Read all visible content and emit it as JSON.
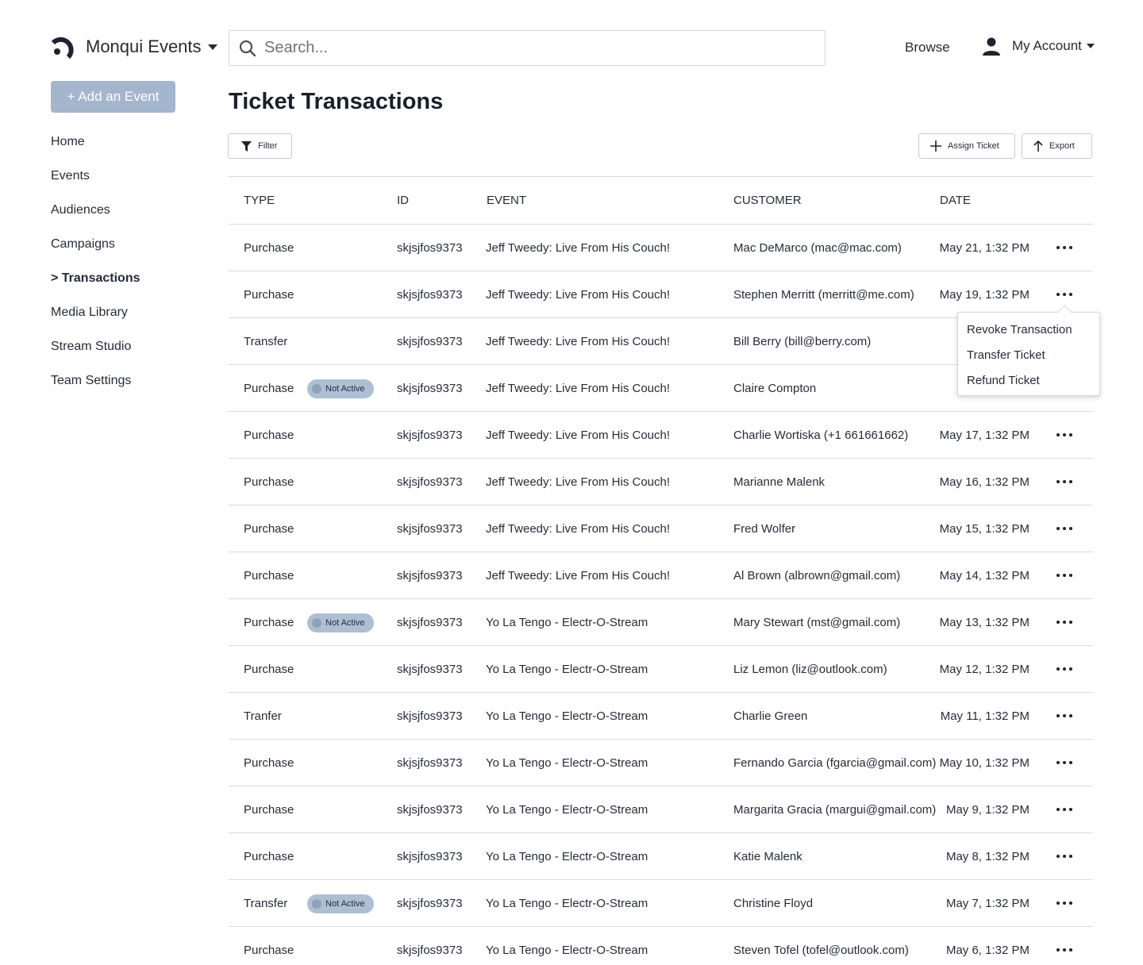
{
  "header": {
    "brand": "Monqui Events",
    "search_placeholder": "Search...",
    "browse": "Browse",
    "account": "My Account"
  },
  "sidebar": {
    "add_event": "+ Add an Event",
    "items": [
      {
        "label": "Home"
      },
      {
        "label": "Events"
      },
      {
        "label": "Audiences"
      },
      {
        "label": "Campaigns"
      },
      {
        "label": "> Transactions",
        "active": true
      },
      {
        "label": "Media Library"
      },
      {
        "label": "Stream Studio"
      },
      {
        "label": "Team Settings"
      }
    ]
  },
  "main": {
    "title": "Ticket Transactions",
    "filter": "Filter",
    "assign": "Assign Ticket",
    "export": "Export",
    "columns": {
      "type": "TYPE",
      "id": "ID",
      "event": "EVENT",
      "customer": "CUSTOMER",
      "date": "DATE"
    },
    "badge_text": "Not Active",
    "rows": [
      {
        "type": "Purchase",
        "id": "skjsjfos9373",
        "event": "Jeff Tweedy: Live From His Couch!",
        "customer": "Mac DeMarco (mac@mac.com)",
        "date": "May 21, 1:32 PM",
        "inactive": false
      },
      {
        "type": "Purchase",
        "id": "skjsjfos9373",
        "event": "Jeff Tweedy: Live From His Couch!",
        "customer": "Stephen Merritt (merritt@me.com)",
        "date": "May 19, 1:32 PM",
        "inactive": false
      },
      {
        "type": "Transfer",
        "id": "skjsjfos9373",
        "event": "Jeff Tweedy: Live From His Couch!",
        "customer": "Bill Berry (bill@berry.com)",
        "date": "Ma",
        "inactive": false
      },
      {
        "type": "Purchase",
        "id": "skjsjfos9373",
        "event": "Jeff Tweedy: Live From His Couch!",
        "customer": "Claire Compton",
        "date": "Ma",
        "inactive": true
      },
      {
        "type": "Purchase",
        "id": "skjsjfos9373",
        "event": "Jeff Tweedy: Live From His Couch!",
        "customer": "Charlie Wortiska (+1 661661662)",
        "date": "May 17, 1:32 PM",
        "inactive": false
      },
      {
        "type": "Purchase",
        "id": "skjsjfos9373",
        "event": "Jeff Tweedy: Live From His Couch!",
        "customer": "Marianne Malenk",
        "date": "May 16, 1:32 PM",
        "inactive": false
      },
      {
        "type": "Purchase",
        "id": "skjsjfos9373",
        "event": "Jeff Tweedy: Live From His Couch!",
        "customer": "Fred Wolfer",
        "date": "May 15, 1:32 PM",
        "inactive": false
      },
      {
        "type": "Purchase",
        "id": "skjsjfos9373",
        "event": "Jeff Tweedy: Live From His Couch!",
        "customer": "Al Brown (albrown@gmail.com)",
        "date": "May 14, 1:32 PM",
        "inactive": false
      },
      {
        "type": "Purchase",
        "id": "skjsjfos9373",
        "event": "Yo La Tengo - Electr-O-Stream",
        "customer": "Mary Stewart (mst@gmail.com)",
        "date": "May 13, 1:32 PM",
        "inactive": true
      },
      {
        "type": "Purchase",
        "id": "skjsjfos9373",
        "event": "Yo La Tengo - Electr-O-Stream",
        "customer": "Liz Lemon (liz@outlook.com)",
        "date": "May 12, 1:32 PM",
        "inactive": false
      },
      {
        "type": "Tranfer",
        "id": "skjsjfos9373",
        "event": "Yo La Tengo - Electr-O-Stream",
        "customer": "Charlie Green",
        "date": "May 11, 1:32 PM",
        "inactive": false
      },
      {
        "type": "Purchase",
        "id": "skjsjfos9373",
        "event": "Yo La Tengo - Electr-O-Stream",
        "customer": "Fernando Garcia (fgarcia@gmail.com)",
        "date": "May 10, 1:32 PM",
        "inactive": false
      },
      {
        "type": "Purchase",
        "id": "skjsjfos9373",
        "event": "Yo La Tengo - Electr-O-Stream",
        "customer": "Margarita Gracia (margui@gmail.com)",
        "date": "May 9, 1:32 PM",
        "inactive": false
      },
      {
        "type": "Purchase",
        "id": "skjsjfos9373",
        "event": "Yo La Tengo - Electr-O-Stream",
        "customer": "Katie Malenk",
        "date": "May 8, 1:32 PM",
        "inactive": false
      },
      {
        "type": "Transfer",
        "id": "skjsjfos9373",
        "event": "Yo La Tengo - Electr-O-Stream",
        "customer": "Christine Floyd",
        "date": "May 7, 1:32 PM",
        "inactive": true
      },
      {
        "type": "Purchase",
        "id": "skjsjfos9373",
        "event": "Yo La Tengo - Electr-O-Stream",
        "customer": "Steven Tofel (tofel@outlook.com)",
        "date": "May 6, 1:32 PM",
        "inactive": false
      }
    ]
  },
  "menu": {
    "items": [
      "Revoke Transaction",
      "Transfer Ticket",
      "Refund Ticket"
    ]
  },
  "colors": {
    "primary_button": "#a3b6cd",
    "badge": "#aebfd3",
    "text": "#262b38"
  }
}
